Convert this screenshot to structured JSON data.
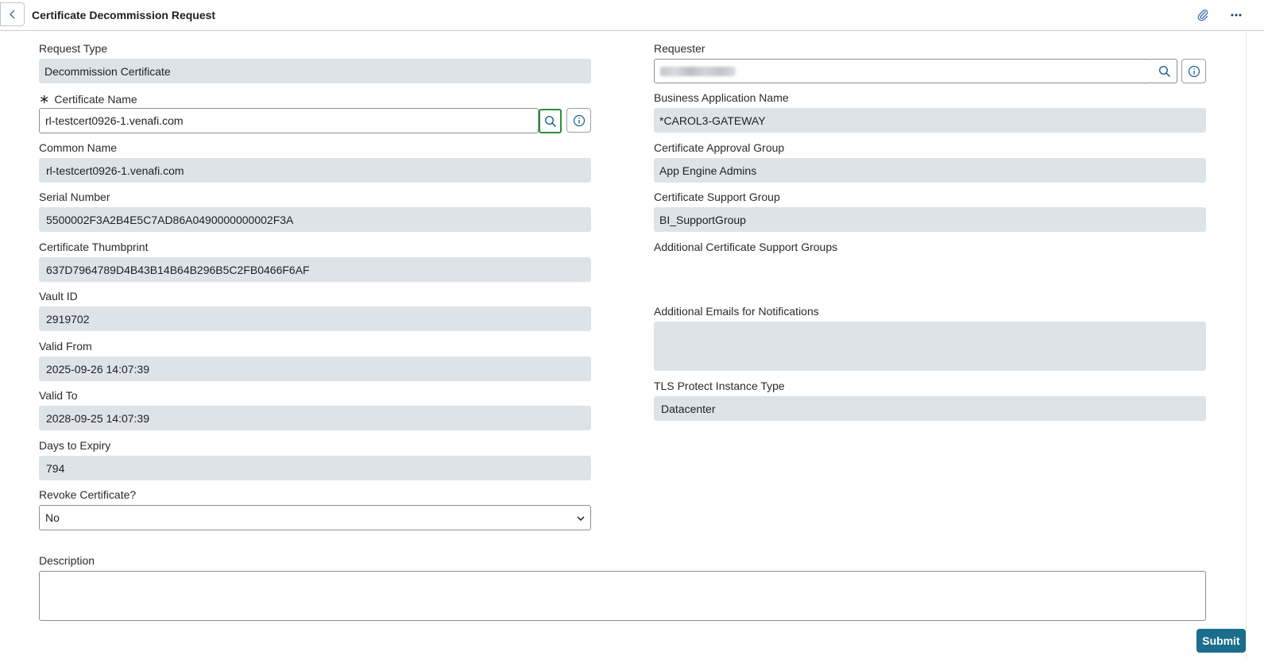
{
  "header": {
    "title": "Certificate Decommission Request",
    "back_icon": "chevron-left-icon",
    "attach_icon": "paperclip-icon",
    "more_icon": "more-horizontal-icon"
  },
  "left": {
    "request_type": {
      "label": "Request Type",
      "value": "Decommission Certificate"
    },
    "certificate_name": {
      "required_mark": "∗",
      "label": "Certificate Name",
      "value": "rl-testcert0926-1.venafi.com"
    },
    "common_name": {
      "label": "Common Name",
      "value": "rl-testcert0926-1.venafi.com"
    },
    "serial_number": {
      "label": "Serial Number",
      "value": "5500002F3A2B4E5C7AD86A0490000000002F3A"
    },
    "thumbprint": {
      "label": "Certificate Thumbprint",
      "value": "637D7964789D4B43B14B64B296B5C2FB0466F6AF"
    },
    "vault_id": {
      "label": "Vault ID",
      "value": "2919702"
    },
    "valid_from": {
      "label": "Valid From",
      "value": "2025-09-26 14:07:39"
    },
    "valid_to": {
      "label": "Valid To",
      "value": "2028-09-25 14:07:39"
    },
    "days_to_expiry": {
      "label": "Days to Expiry",
      "value": "794"
    },
    "revoke": {
      "label": "Revoke Certificate?",
      "value": "No"
    }
  },
  "right": {
    "requester": {
      "label": "Requester"
    },
    "business_app": {
      "label": "Business Application Name",
      "value": "*CAROL3-GATEWAY"
    },
    "approval_group": {
      "label": "Certificate Approval Group",
      "value": "App Engine Admins"
    },
    "support_group": {
      "label": "Certificate Support Group",
      "value": "BI_SupportGroup"
    },
    "additional_support_groups": {
      "label": "Additional Certificate Support Groups"
    },
    "additional_emails": {
      "label": "Additional Emails for Notifications",
      "value": ""
    },
    "tls_type": {
      "label": "TLS Protect Instance Type",
      "value": "Datacenter"
    }
  },
  "description": {
    "label": "Description",
    "value": ""
  },
  "submit_label": "Submit",
  "colors": {
    "accent": "#1a6e8c",
    "readonly_bg": "#dee3e8",
    "focus": "#2e8b3e"
  }
}
